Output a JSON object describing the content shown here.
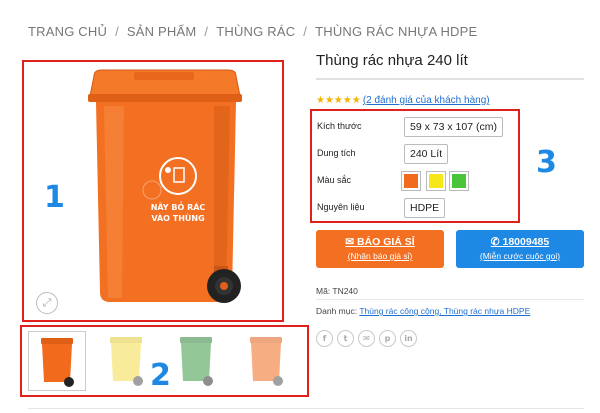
{
  "breadcrumb": {
    "items": [
      "TRANG CHỦ",
      "SẢN PHẨM",
      "THÙNG RÁC",
      "THÙNG RÁC NHỰA HDPE"
    ],
    "separator": "/"
  },
  "gallery": {
    "bin_label_line1": "NÂY BỎ RÁC",
    "bin_label_line2": "VÀO THÙNG",
    "thumbnail_colors": [
      "#f26b1d",
      "#f3de4a",
      "#3e9a45",
      "#f26b1d"
    ]
  },
  "callouts": {
    "one": "1",
    "two": "2",
    "three": "3"
  },
  "product": {
    "title": "Thùng rác nhựa 240 lít",
    "stars": "★★★★★",
    "review_link": "(2 đánh giá của khách hàng)",
    "attributes": {
      "size_label": "Kích thước",
      "size_value": "59 x 73 x 107 (cm)",
      "capacity_label": "Dung tích",
      "capacity_value": "240 Lít",
      "color_label": "Màu sắc",
      "color_swatches": [
        "#f26b1d",
        "#f5e71a",
        "#4ac53a"
      ],
      "material_label": "Nguyên liệu",
      "material_value": "HDPE"
    },
    "buttons": {
      "quote_main": "BÁO GIÁ SỈ",
      "quote_sub": "(Nhận báo giá sỉ)",
      "call_main": "18009485",
      "call_sub": "(Miễn cước cuộc gọi)"
    },
    "sku": "Mã: TN240",
    "categories_label": "Danh mục:",
    "categories_value": "Thùng rác công cộng, Thùng rác nhựa HDPE"
  },
  "share_icons": [
    "facebook-icon",
    "twitter-icon",
    "email-icon",
    "pinterest-icon",
    "linkedin-icon"
  ],
  "colors": {
    "accent_orange": "#f37023",
    "accent_blue": "#1e88e5",
    "highlight_red": "#e0201b",
    "link_blue": "#1e6fd0"
  }
}
